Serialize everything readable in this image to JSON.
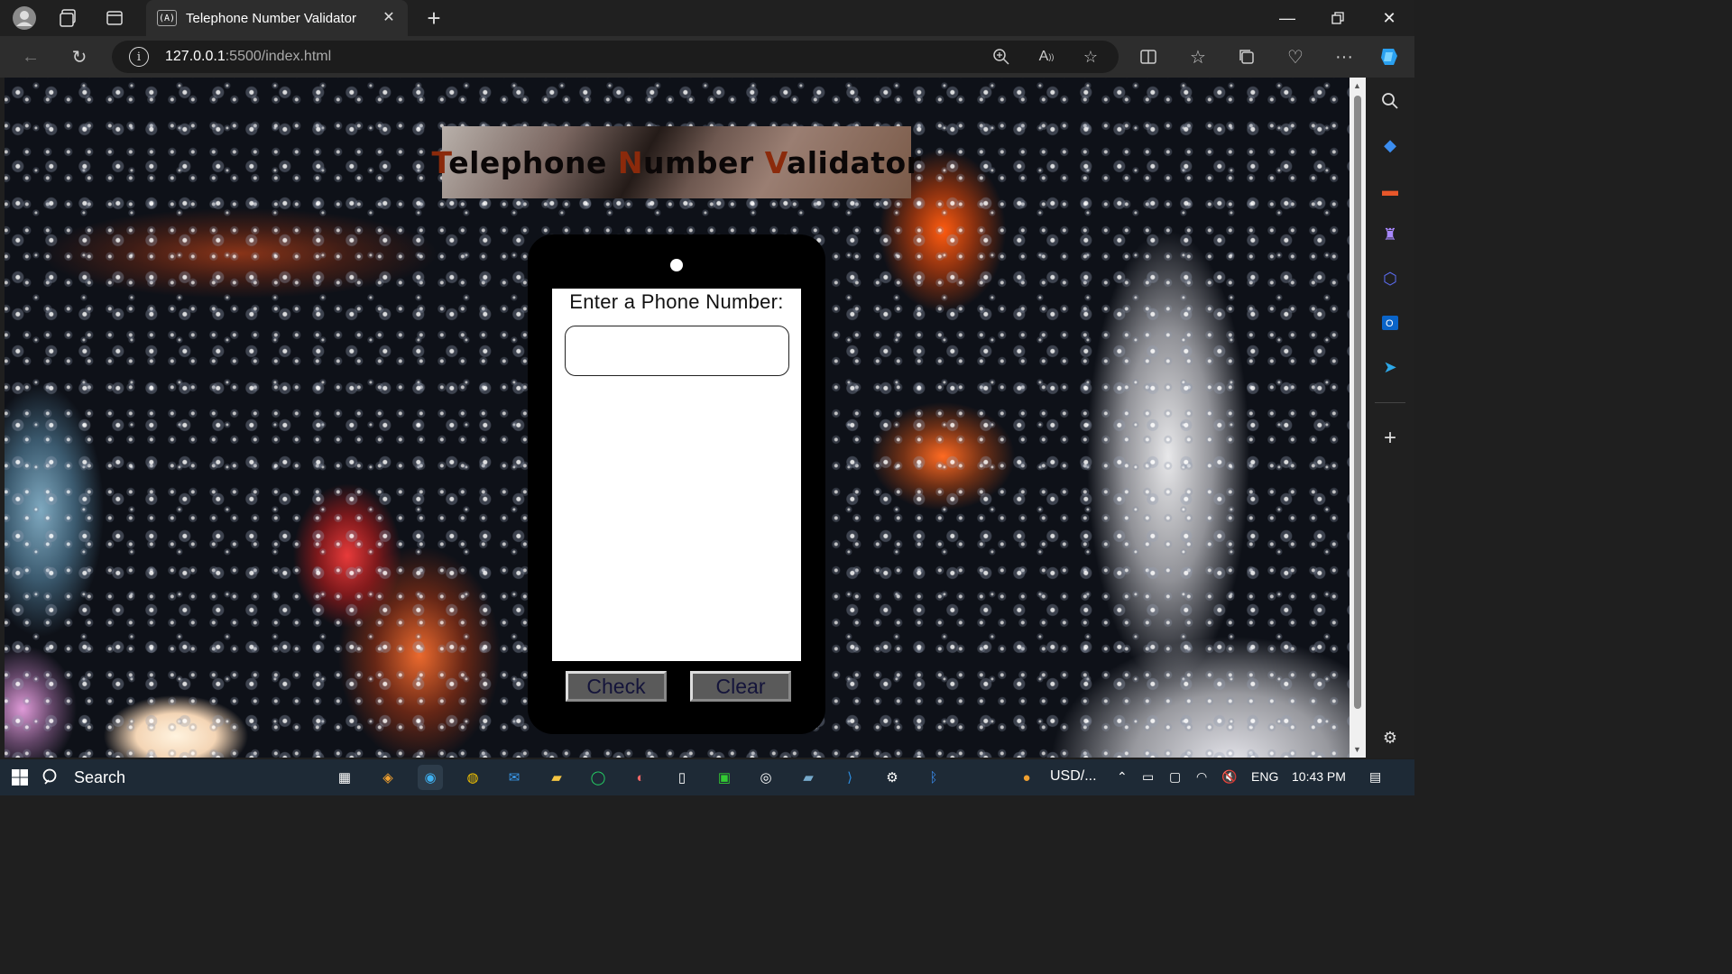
{
  "browser": {
    "tab_title": "Telephone Number Validator",
    "tab_favicon": "(A)",
    "url_host": "127.0.0.1",
    "url_rest": ":5500/index.html"
  },
  "page": {
    "heading_parts": [
      {
        "text": "T",
        "highlight": true
      },
      {
        "text": "elephone ",
        "highlight": false
      },
      {
        "text": "N",
        "highlight": true
      },
      {
        "text": "umber ",
        "highlight": false
      },
      {
        "text": "V",
        "highlight": true
      },
      {
        "text": "alidator",
        "highlight": false
      }
    ],
    "input_label": "Enter a Phone Number:",
    "input_value": "",
    "check_label": "Check",
    "clear_label": "Clear"
  },
  "taskbar": {
    "search_label": "Search",
    "currency_text": "USD/...",
    "language": "ENG",
    "time": "10:43 PM"
  },
  "colors": {
    "heading_highlight": "#8b2a0b",
    "phone_body": "#000000",
    "button_bg": "#5a5a5a"
  }
}
